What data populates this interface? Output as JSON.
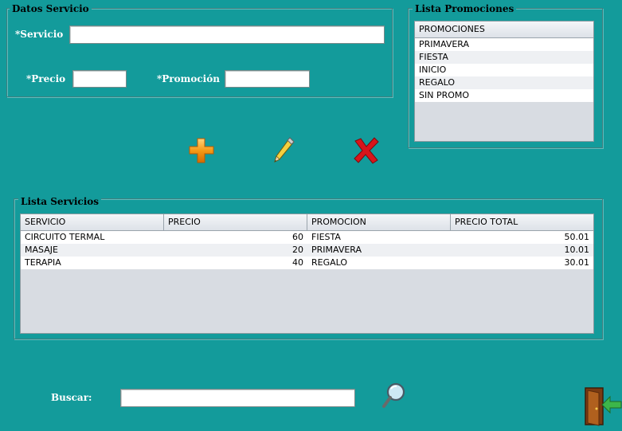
{
  "datos": {
    "title": "Datos Servicio",
    "servicio_label": "*Servicio",
    "servicio_value": "",
    "precio_label": "*Precio",
    "precio_value": "",
    "promocion_label": "*Promoción",
    "promocion_value": ""
  },
  "actions": {
    "add_icon": "plus-icon",
    "edit_icon": "pencil-icon",
    "delete_icon": "red-x-icon"
  },
  "promociones": {
    "title": "Lista Promociones",
    "header": "PROMOCIONES",
    "items": [
      "PRIMAVERA",
      "FIESTA",
      "INICIO",
      "REGALO",
      "SIN PROMO"
    ]
  },
  "servicios": {
    "title": "Lista Servicios",
    "columns": [
      "SERVICIO",
      "PRECIO",
      "PROMOCION",
      "PRECIO TOTAL"
    ],
    "rows": [
      [
        "CIRCUITO TERMAL",
        "60",
        "FIESTA",
        "50.01"
      ],
      [
        "MASAJE",
        "20",
        "PRIMAVERA",
        "10.01"
      ],
      [
        "TERAPIA",
        "40",
        "REGALO",
        "30.01"
      ]
    ]
  },
  "buscar": {
    "label": "Buscar:",
    "value": "",
    "search_icon": "magnifier-icon",
    "exit_icon": "exit-door-icon"
  },
  "colors": {
    "background": "#139b9b",
    "label_text": "#ffffff",
    "title_text": "#000000"
  }
}
